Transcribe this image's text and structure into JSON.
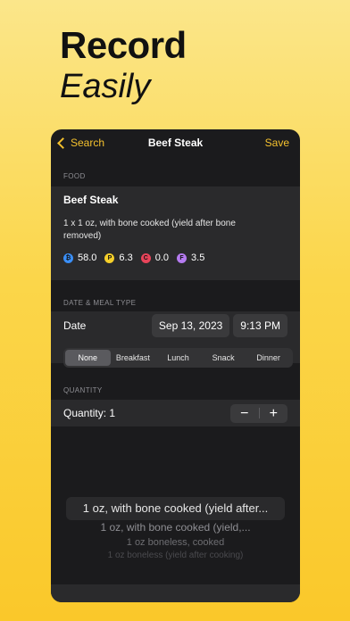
{
  "headline": {
    "line1": "Record",
    "line2": "Easily"
  },
  "nav": {
    "back_label": "Search",
    "title": "Beef Steak",
    "save_label": "Save"
  },
  "food": {
    "section_label": "FOOD",
    "name": "Beef Steak",
    "description": "1 x 1 oz, with bone cooked (yield after bone removed)",
    "macros": [
      {
        "letter": "₿",
        "value": "58.0",
        "color": "#3a8ef6"
      },
      {
        "letter": "P",
        "value": "6.3",
        "color": "#f5cf2a"
      },
      {
        "letter": "C",
        "value": "0.0",
        "color": "#e8445a"
      },
      {
        "letter": "F",
        "value": "3.5",
        "color": "#b57bf0"
      }
    ]
  },
  "date_meal": {
    "section_label": "DATE & MEAL TYPE",
    "date_label": "Date",
    "date_value": "Sep 13, 2023",
    "time_value": "9:13 PM",
    "meal_types": [
      "None",
      "Breakfast",
      "Lunch",
      "Snack",
      "Dinner"
    ],
    "selected_meal": "None"
  },
  "quantity": {
    "section_label": "QUANTITY",
    "label": "Quantity: 1",
    "minus": "−",
    "plus": "+"
  },
  "picker": {
    "options": [
      "1 oz, with bone cooked (yield after...",
      "1 oz, with bone cooked (yield,...",
      "1 oz boneless, cooked",
      "1 oz boneless (yield after cooking)"
    ]
  }
}
